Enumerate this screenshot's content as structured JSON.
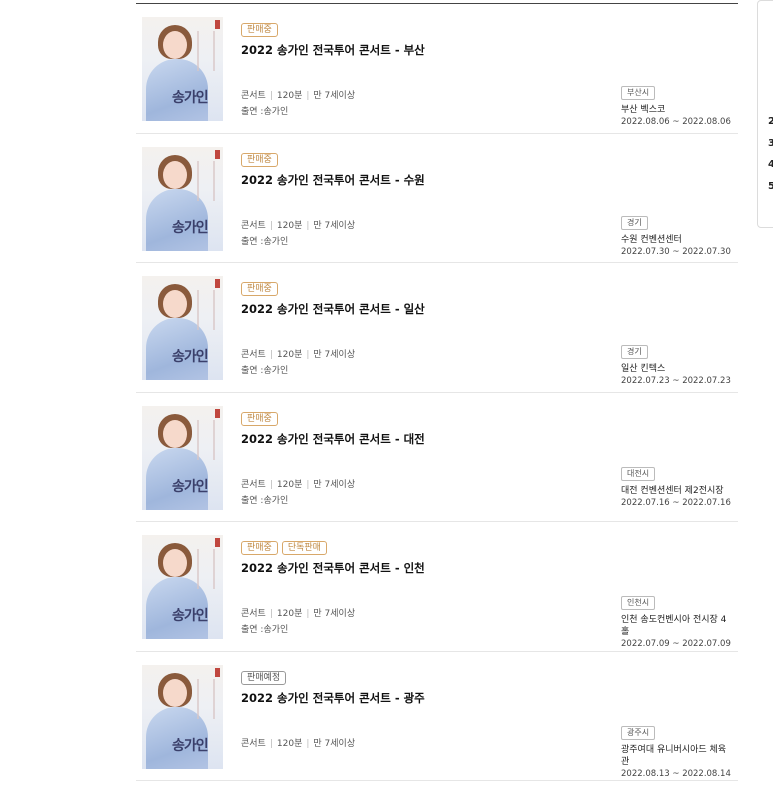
{
  "events": [
    {
      "badges": [
        {
          "label": "판매중",
          "type": "sale"
        }
      ],
      "title": "2022 송가인 전국투어 콘서트 - 부산",
      "genre": "콘서트",
      "duration": "120분",
      "age": "만 7세이상",
      "cast": "출연 :송가인",
      "region": "부산시",
      "venue": "부산 벡스코",
      "dates": "2022.08.06 ~ 2022.08.06",
      "poster_title": "송가인"
    },
    {
      "badges": [
        {
          "label": "판매중",
          "type": "sale"
        }
      ],
      "title": "2022 송가인 전국투어 콘서트 - 수원",
      "genre": "콘서트",
      "duration": "120분",
      "age": "만 7세이상",
      "cast": "출연 :송가인",
      "region": "경기",
      "venue": "수원 컨벤션센터",
      "dates": "2022.07.30 ~ 2022.07.30",
      "poster_title": "송가인"
    },
    {
      "badges": [
        {
          "label": "판매중",
          "type": "sale"
        }
      ],
      "title": "2022 송가인 전국투어 콘서트 - 일산",
      "genre": "콘서트",
      "duration": "120분",
      "age": "만 7세이상",
      "cast": "출연 :송가인",
      "region": "경기",
      "venue": "일산 킨텍스",
      "dates": "2022.07.23 ~ 2022.07.23",
      "poster_title": "송가인"
    },
    {
      "badges": [
        {
          "label": "판매중",
          "type": "sale"
        }
      ],
      "title": "2022 송가인 전국투어 콘서트 - 대전",
      "genre": "콘서트",
      "duration": "120분",
      "age": "만 7세이상",
      "cast": "출연 :송가인",
      "region": "대전시",
      "venue": "대전 컨벤션센터 제2전시장",
      "dates": "2022.07.16 ~ 2022.07.16",
      "poster_title": "송가인"
    },
    {
      "badges": [
        {
          "label": "판매중",
          "type": "sale"
        },
        {
          "label": "단독판매",
          "type": "sale"
        }
      ],
      "title": "2022 송가인 전국투어 콘서트 - 인천",
      "genre": "콘서트",
      "duration": "120분",
      "age": "만 7세이상",
      "cast": "출연 :송가인",
      "region": "인천시",
      "venue": "인천 송도컨벤시아 전시장 4홀",
      "dates": "2022.07.09 ~ 2022.07.09",
      "poster_title": "송가인"
    },
    {
      "badges": [
        {
          "label": "판매예정",
          "type": "pre"
        }
      ],
      "title": "2022 송가인 전국투어 콘서트 - 광주",
      "genre": "콘서트",
      "duration": "120분",
      "age": "만 7세이상",
      "cast": "",
      "region": "광주시",
      "venue": "광주여대 유니버시아드 체육관",
      "dates": "2022.08.13 ~ 2022.08.14",
      "poster_title": "송가인"
    }
  ],
  "side_panel": {
    "ranks": [
      "2",
      "3",
      "4",
      "5"
    ]
  },
  "colors": {
    "sale_badge": "#c08a45",
    "pre_badge": "#555555",
    "top_border": "#444444"
  }
}
